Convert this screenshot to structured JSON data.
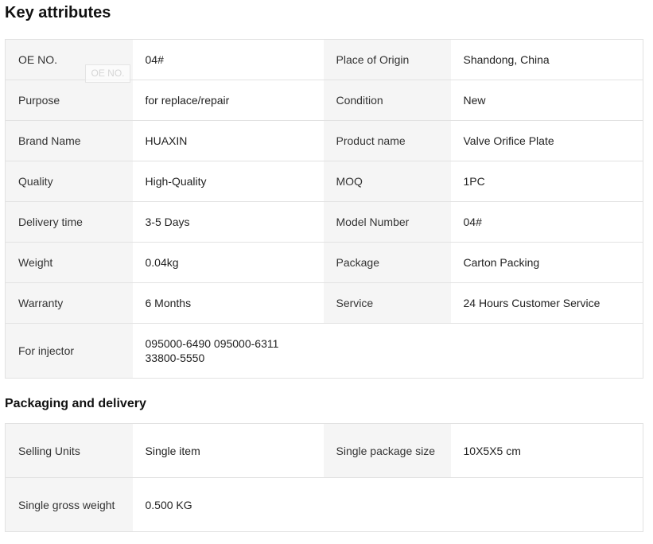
{
  "key_attributes": {
    "title": "Key attributes",
    "rows": [
      [
        {
          "k": "OE NO.",
          "v": "04#"
        },
        {
          "k": "Place of Origin",
          "v": "Shandong, China"
        }
      ],
      [
        {
          "k": "Purpose",
          "v": "for replace/repair"
        },
        {
          "k": "Condition",
          "v": "New"
        }
      ],
      [
        {
          "k": "Brand Name",
          "v": "HUAXIN"
        },
        {
          "k": "Product name",
          "v": "Valve Orifice Plate"
        }
      ],
      [
        {
          "k": "Quality",
          "v": "High-Quality"
        },
        {
          "k": "MOQ",
          "v": "1PC"
        }
      ],
      [
        {
          "k": "Delivery time",
          "v": "3-5 Days"
        },
        {
          "k": "Model Number",
          "v": "04#"
        }
      ],
      [
        {
          "k": "Weight",
          "v": "0.04kg"
        },
        {
          "k": "Package",
          "v": "Carton Packing"
        }
      ],
      [
        {
          "k": "Warranty",
          "v": "6 Months"
        },
        {
          "k": "Service",
          "v": "24 Hours Customer Service"
        }
      ],
      [
        {
          "k": "For injector",
          "v": "095000-6490 095000-6311 33800-5550"
        }
      ]
    ],
    "watermark": "OE NO."
  },
  "packaging": {
    "title": "Packaging and delivery",
    "rows": [
      [
        {
          "k": "Selling Units",
          "v": "Single item"
        },
        {
          "k": "Single package size",
          "v": "10X5X5 cm"
        }
      ],
      [
        {
          "k": "Single gross weight",
          "v": "0.500 KG"
        }
      ]
    ]
  }
}
